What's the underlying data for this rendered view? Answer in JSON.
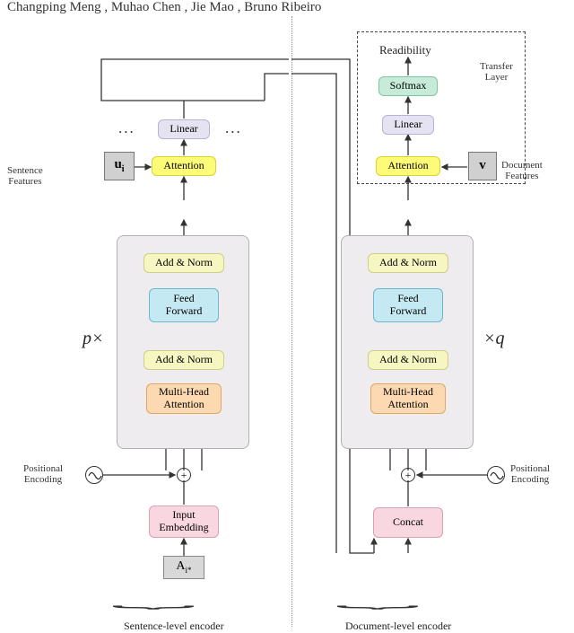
{
  "authors": "Changping Meng , Muhao Chen , Jie Mao , Bruno Ribeiro",
  "left": {
    "linear": "Linear",
    "attention": "Attention",
    "addnorm1": "Add & Norm",
    "ffwd": "Feed\nForward",
    "addnorm2": "Add & Norm",
    "mha": "Multi-Head\nAttention",
    "embed": "Input\nEmbedding",
    "input": "A",
    "input_sub": "i*",
    "feat": "u",
    "feat_sub": "i",
    "feat_label": "Sentence\nFeatures",
    "pos": "Positional\nEncoding",
    "mult": "p×",
    "caption": "Sentence-level encoder"
  },
  "right": {
    "readability": "Readibility",
    "softmax": "Softmax",
    "linear": "Linear",
    "attention": "Attention",
    "addnorm1": "Add & Norm",
    "ffwd": "Feed\nForward",
    "addnorm2": "Add & Norm",
    "mha": "Multi-Head\nAttention",
    "concat": "Concat",
    "feat": "v",
    "feat_label": "Document\nFeatures",
    "transfer": "Transfer\nLayer",
    "pos": "Positional\nEncoding",
    "mult": "×q",
    "caption": "Document-level encoder"
  }
}
